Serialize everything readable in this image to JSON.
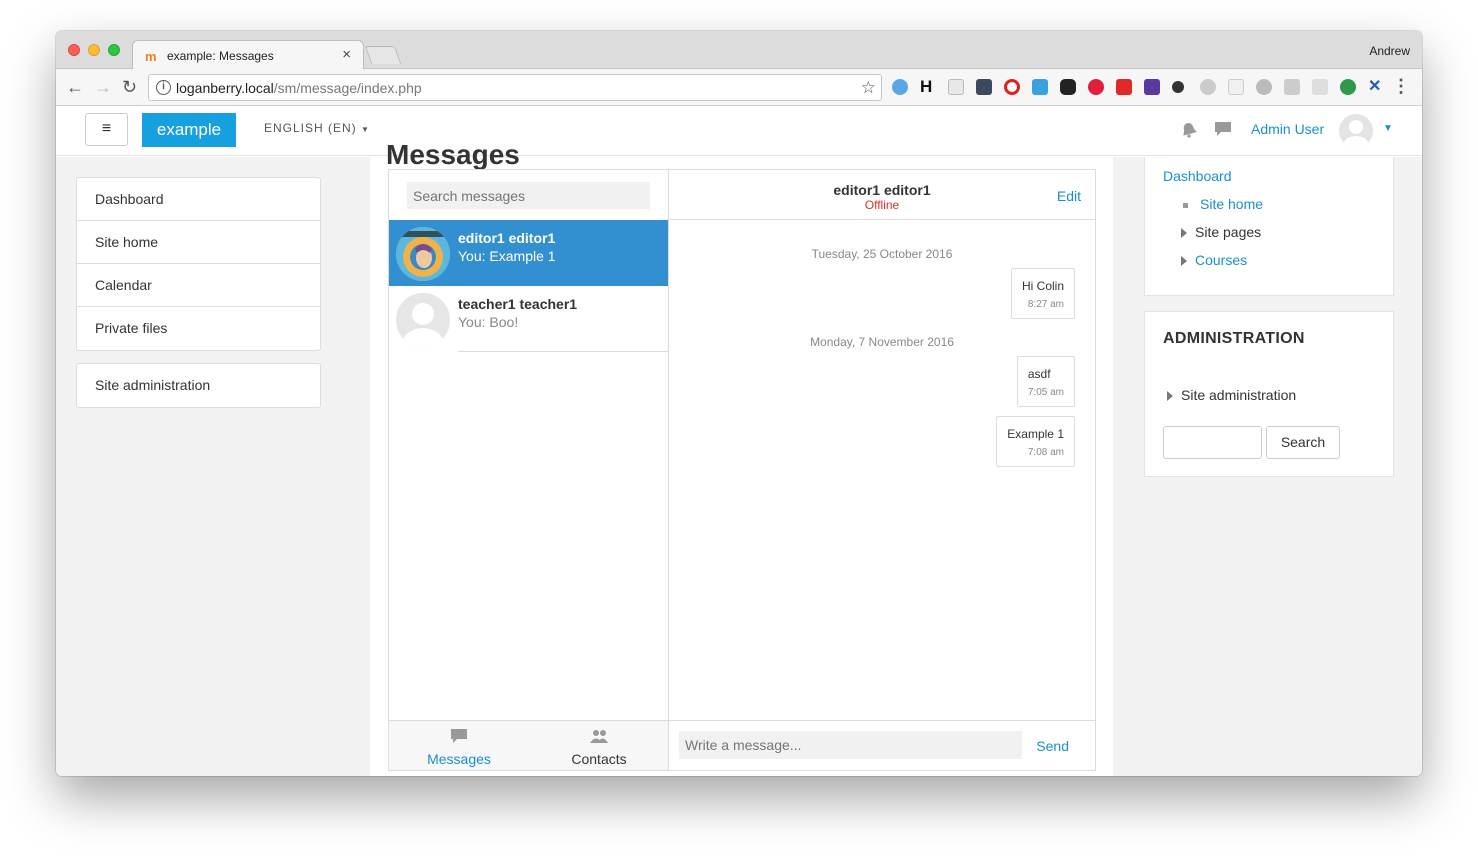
{
  "browser": {
    "tab_title": "example: Messages",
    "tab_close": "×",
    "profile_name": "Andrew",
    "url_host": "loganberry.local",
    "url_path": "/sm/message/index.php"
  },
  "header": {
    "menu_icon": "≡",
    "brand": "example",
    "language": "ENGLISH (EN)",
    "user_name": "Admin User"
  },
  "nav": {
    "items": [
      {
        "label": "Dashboard"
      },
      {
        "label": "Site home"
      },
      {
        "label": "Calendar"
      },
      {
        "label": "Private files"
      }
    ],
    "admin_item": "Site administration"
  },
  "page": {
    "title": "Messages"
  },
  "messages": {
    "search_placeholder": "Search messages",
    "conversations": [
      {
        "name": "editor1 editor1",
        "preview": "You: Example 1",
        "active": true
      },
      {
        "name": "teacher1 teacher1",
        "preview": "You: Boo!",
        "active": false
      }
    ],
    "tabs": {
      "messages": "Messages",
      "contacts": "Contacts"
    },
    "chat": {
      "name": "editor1 editor1",
      "status": "Offline",
      "edit": "Edit",
      "groups": [
        {
          "date": "Tuesday, 25 October 2016",
          "items": [
            {
              "text": "Hi Colin",
              "time": "8:27 am"
            }
          ]
        },
        {
          "date": "Monday, 7 November 2016",
          "items": [
            {
              "text": "asdf",
              "time": "7:05 am"
            },
            {
              "text": "Example 1",
              "time": "7:08 am"
            }
          ]
        }
      ],
      "compose_placeholder": "Write a message...",
      "send": "Send"
    }
  },
  "navigation_block": {
    "dashboard": "Dashboard",
    "site_home": "Site home",
    "site_pages": "Site pages",
    "courses": "Courses"
  },
  "admin_block": {
    "title": "ADMINISTRATION",
    "site_admin": "Site administration",
    "search_button": "Search"
  },
  "colors": {
    "brand": "#16a0e0",
    "link": "#1a8fd0",
    "active_conversation": "#3390d0",
    "offline": "#e0302a"
  }
}
